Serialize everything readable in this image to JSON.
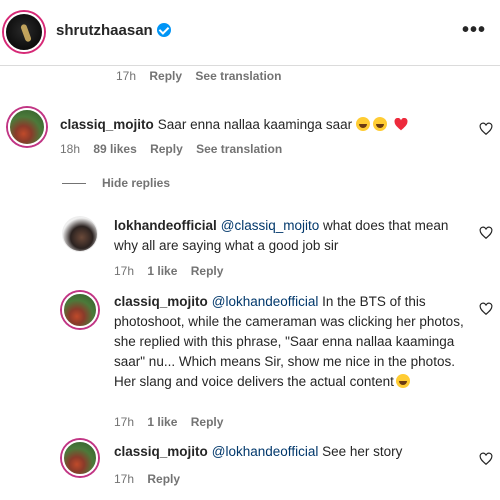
{
  "post": {
    "username": "shrutzhaasan",
    "more_label": "•••"
  },
  "caption_meta": {
    "time": "17h",
    "reply": "Reply",
    "see_translation": "See translation"
  },
  "comments": [
    {
      "username": "classiq_mojito",
      "text": "Saar enna nallaa kaaminga saar",
      "time": "18h",
      "likes": "89 likes",
      "reply": "Reply",
      "see_translation": "See translation"
    }
  ],
  "hide_replies": "Hide replies",
  "replies": [
    {
      "username": "lokhandeofficial",
      "mention": "@classiq_mojito",
      "text": " what does that mean why all are saying what a good job sir",
      "time": "17h",
      "likes": "1 like",
      "reply": "Reply"
    },
    {
      "username": "classiq_mojito",
      "mention": "@lokhandeofficial",
      "text": " In the BTS of this photoshoot, while the cameraman was clicking her photos, she replied with this phrase, \"Saar enna nallaa kaaminga saar\" nu... Which means Sir, show me nice in the photos. Her slang and voice delivers the actual content",
      "time": "17h",
      "likes": "1 like",
      "reply": "Reply"
    },
    {
      "username": "classiq_mojito",
      "mention": "@lokhandeofficial",
      "text": " See her story",
      "time": "17h",
      "likes": "",
      "reply": "Reply"
    }
  ],
  "colors": {
    "accent_blue": "#0095f6",
    "mention": "#00376b",
    "muted": "#737373",
    "heart_red": "#ed2a3c"
  }
}
